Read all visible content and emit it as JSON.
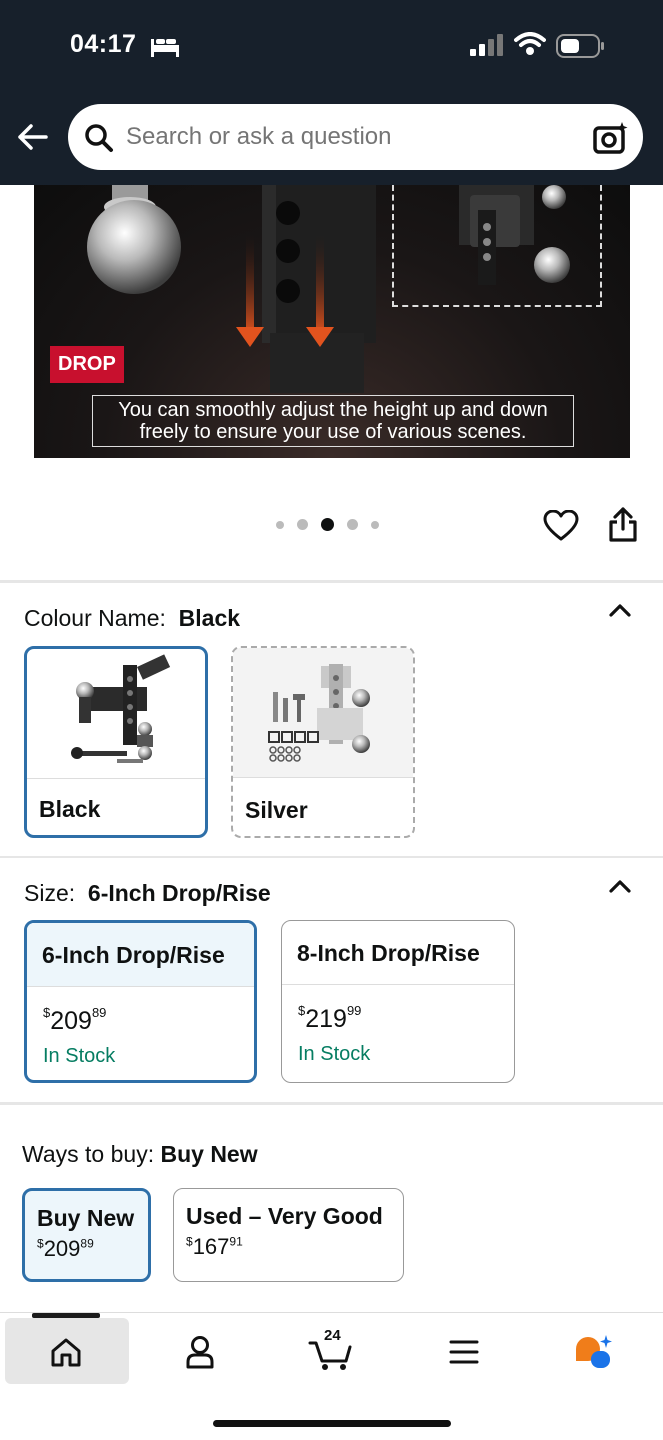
{
  "status_bar": {
    "time": "04:17"
  },
  "header": {
    "search_placeholder": "Search or ask a question"
  },
  "product_image": {
    "badge": "DROP",
    "caption": "You can smoothly adjust the height up and down freely to ensure your use of various scenes.",
    "carousel": {
      "count": 5,
      "active_index": 2
    }
  },
  "colour": {
    "label": "Colour Name:",
    "selected_value": "Black",
    "options": [
      {
        "label": "Black",
        "selected": true
      },
      {
        "label": "Silver",
        "selected": false
      }
    ]
  },
  "size": {
    "label": "Size:",
    "selected_value": "6-Inch Drop/Rise",
    "options": [
      {
        "label": "6-Inch Drop/Rise",
        "price_symbol": "$",
        "price_whole": "209",
        "price_fraction": "89",
        "stock": "In Stock",
        "selected": true
      },
      {
        "label": "8-Inch Drop/Rise",
        "price_symbol": "$",
        "price_whole": "219",
        "price_fraction": "99",
        "stock": "In Stock",
        "selected": false
      }
    ]
  },
  "ways_to_buy": {
    "label": "Ways to buy:",
    "selected_value": "Buy New",
    "options": [
      {
        "label": "Buy New",
        "price_symbol": "$",
        "price_whole": "209",
        "price_fraction": "89",
        "selected": true
      },
      {
        "label": "Used – Very Good",
        "price_symbol": "$",
        "price_whole": "167",
        "price_fraction": "91",
        "selected": false
      }
    ]
  },
  "bottom_nav": {
    "items": [
      {
        "icon": "home-icon",
        "active": true
      },
      {
        "icon": "account-icon"
      },
      {
        "icon": "cart-icon",
        "badge": "24"
      },
      {
        "icon": "menu-icon"
      },
      {
        "icon": "rufus-assistant-icon"
      }
    ]
  },
  "colors": {
    "header_bg": "#17202b",
    "selected_border": "#2e6fa8",
    "selected_fill": "#edf6fb",
    "in_stock": "#067d62",
    "badge_red": "#c8102e",
    "assistant_orange": "#f07d1a",
    "assistant_blue": "#1a73e8"
  }
}
